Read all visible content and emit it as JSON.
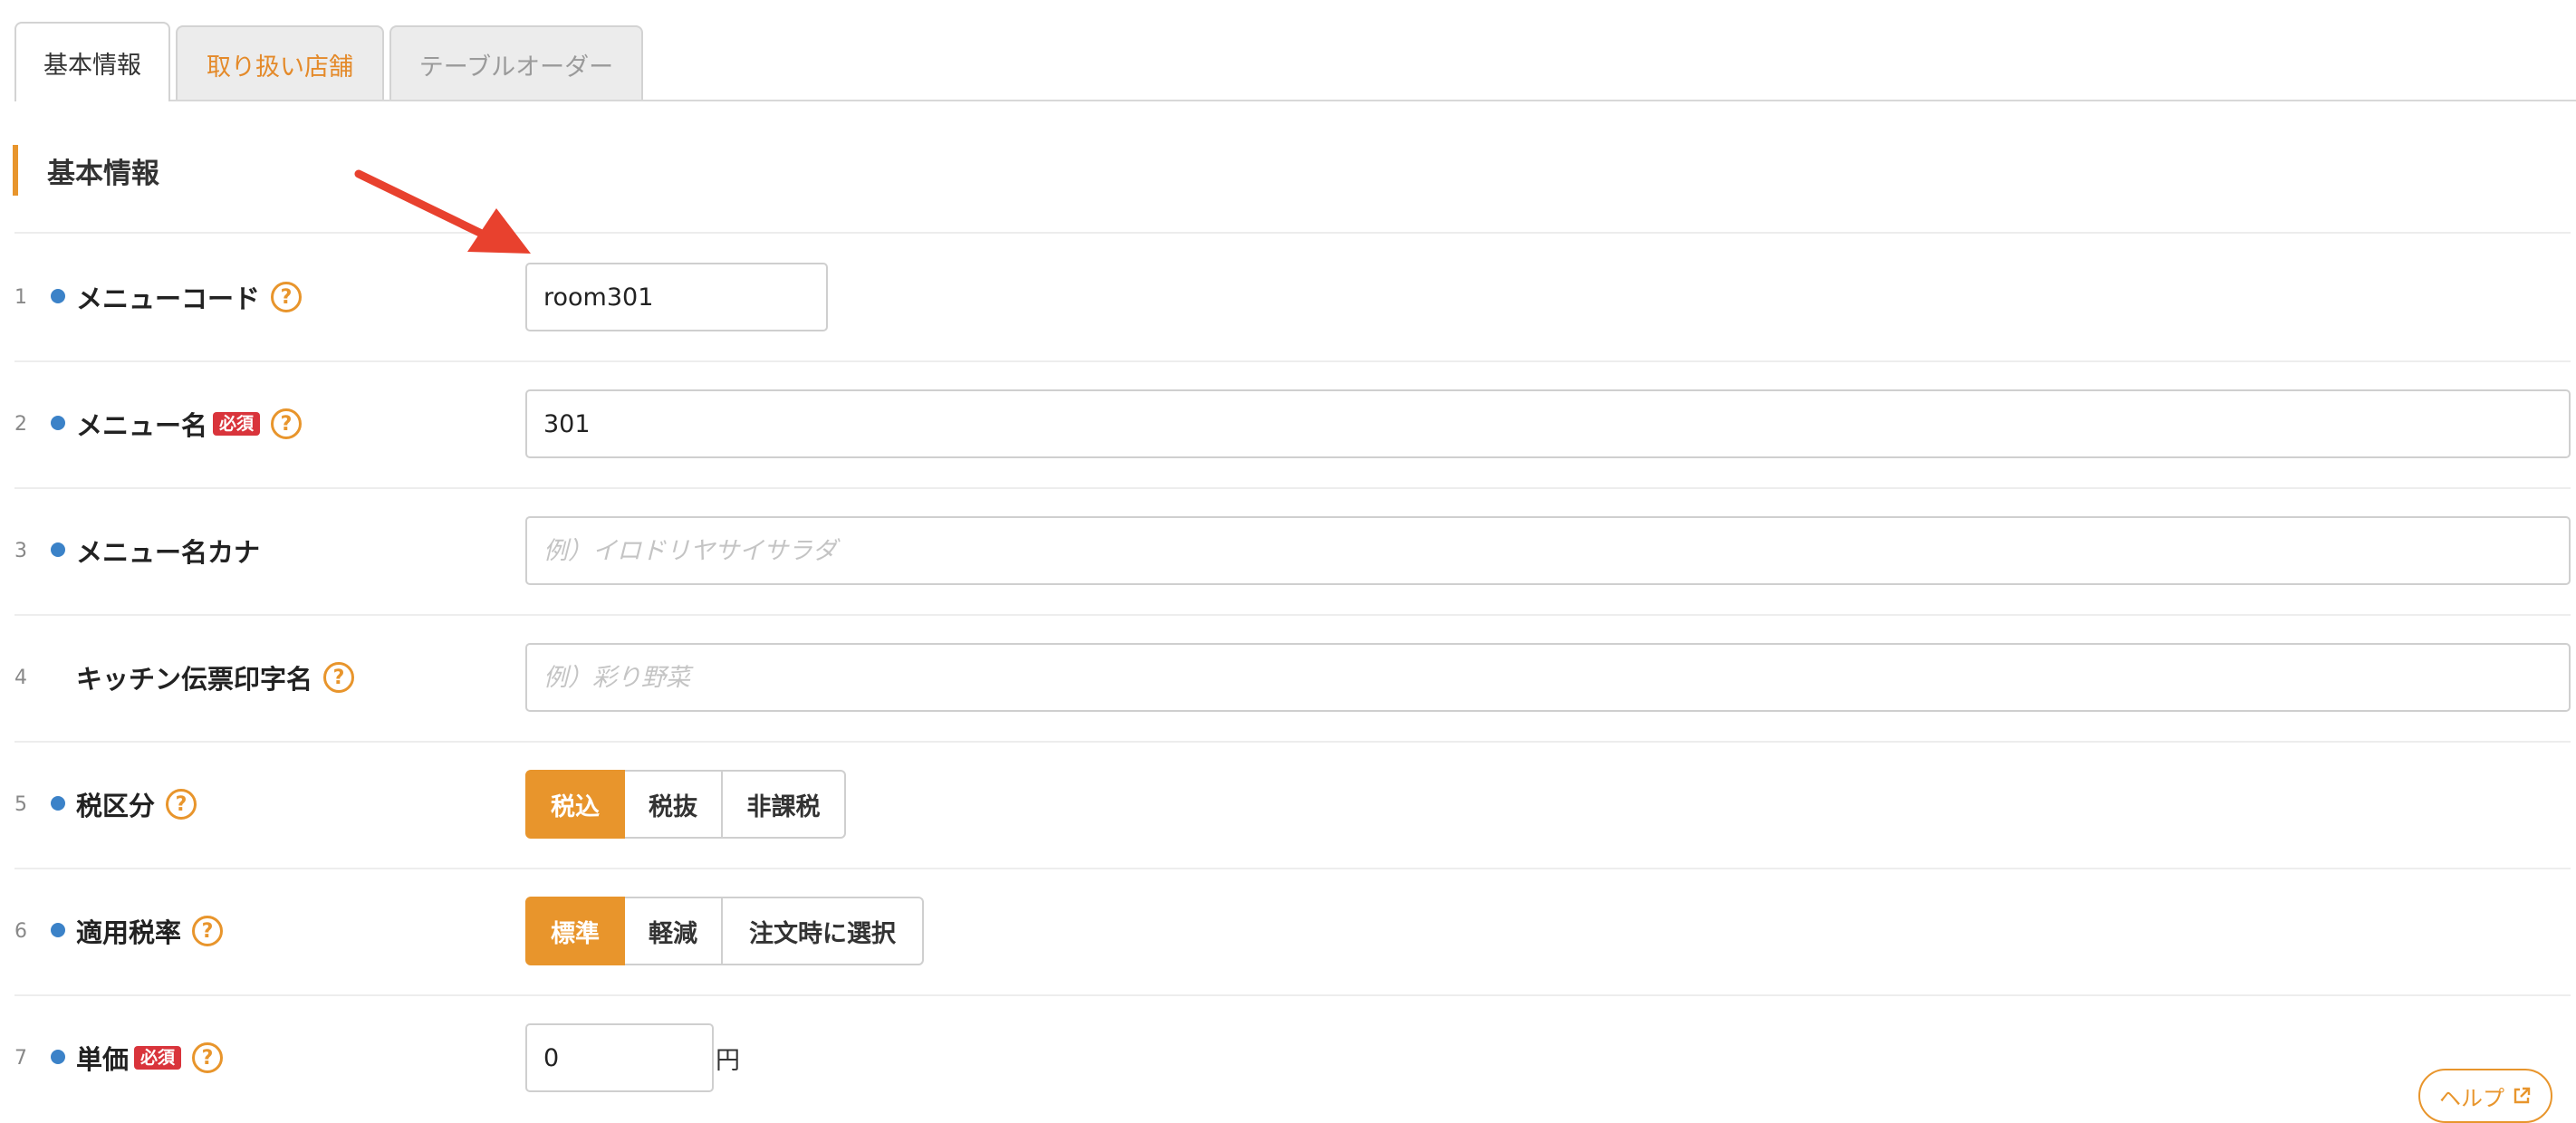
{
  "tabs": [
    {
      "label": "基本情報",
      "state": "active"
    },
    {
      "label": "取り扱い店舗",
      "state": "inactive"
    },
    {
      "label": "テーブルオーダー",
      "state": "disabled"
    }
  ],
  "section": {
    "title": "基本情報"
  },
  "required_badge": "必須",
  "help_glyph": "?",
  "rows": [
    {
      "num": "1",
      "label": "メニューコード",
      "value": "room301",
      "placeholder": ""
    },
    {
      "num": "2",
      "label": "メニュー名",
      "value": "301",
      "placeholder": ""
    },
    {
      "num": "3",
      "label": "メニュー名カナ",
      "value": "",
      "placeholder": "例）イロドリヤサイサラダ"
    },
    {
      "num": "4",
      "label": "キッチン伝票印字名",
      "value": "",
      "placeholder": "例）彩り野菜"
    },
    {
      "num": "5",
      "label": "税区分",
      "options": [
        "税込",
        "税抜",
        "非課税"
      ],
      "selected": "税込"
    },
    {
      "num": "6",
      "label": "適用税率",
      "options": [
        "標準",
        "軽減",
        "注文時に選択"
      ],
      "selected": "標準"
    },
    {
      "num": "7",
      "label": "単価",
      "value": "0",
      "unit": "円"
    }
  ],
  "help_button": {
    "label": "ヘルプ"
  },
  "colors": {
    "accent": "#e8952c",
    "dot": "#3b82c8",
    "required": "#d9343b",
    "arrow": "#e8412e"
  }
}
